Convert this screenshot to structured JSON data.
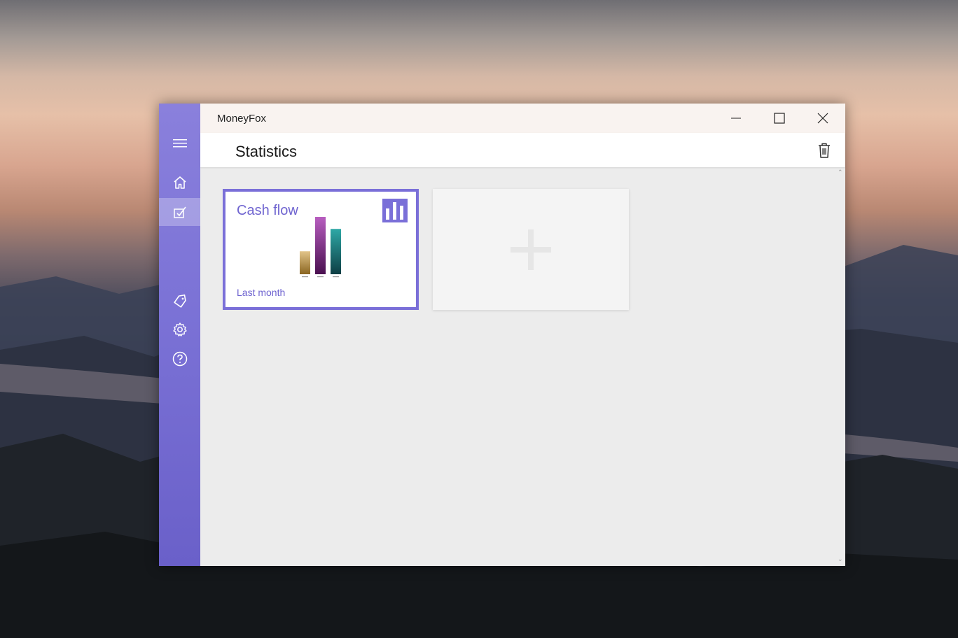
{
  "window": {
    "title": "MoneyFox",
    "controls": {
      "minimize_icon": "minimize-icon",
      "maximize_icon": "maximize-icon",
      "close_icon": "close-icon"
    }
  },
  "nav": {
    "items": [
      {
        "icon": "hamburger-menu-icon",
        "selected": false
      },
      {
        "icon": "home-icon",
        "selected": false
      },
      {
        "icon": "statistics-icon",
        "selected": true
      },
      {
        "icon": "tag-icon",
        "selected": false
      },
      {
        "icon": "gear-icon",
        "selected": false
      },
      {
        "icon": "help-icon",
        "selected": false
      }
    ]
  },
  "header": {
    "title": "Statistics",
    "delete_icon": "trash-icon"
  },
  "tiles": [
    {
      "title": "Cash flow",
      "subtitle": "Last month",
      "icon": "bar-chart-icon",
      "chart_data": {
        "type": "bar",
        "categories": [
          "",
          "",
          ""
        ],
        "values": [
          0.4,
          1.0,
          0.79
        ],
        "colors": [
          "#b08a3a",
          "#8a3a8e",
          "#1f7f7c"
        ]
      }
    },
    {
      "icon": "plus-icon"
    }
  ],
  "colors": {
    "accent": "#7a6fd8",
    "nav_top": "#8a80dc",
    "nav_bottom": "#6a60c9",
    "content_bg": "#ececec"
  }
}
